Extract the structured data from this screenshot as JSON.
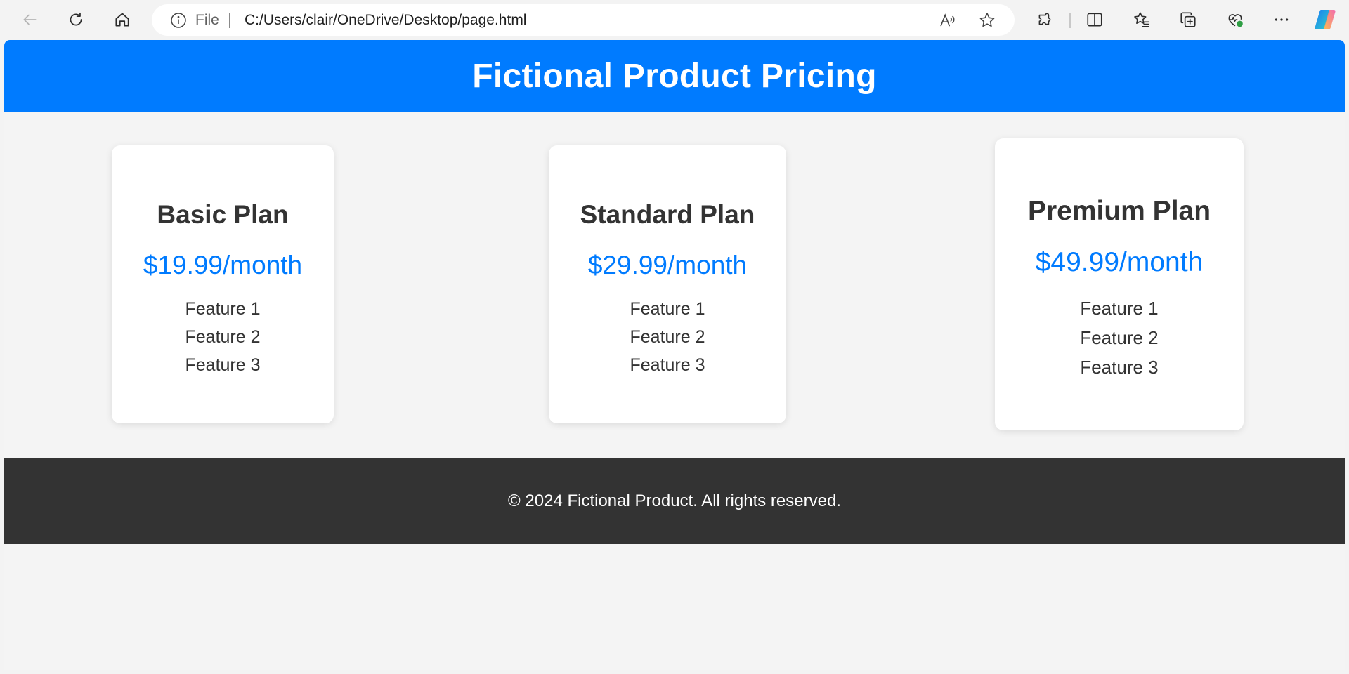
{
  "browser": {
    "address": {
      "scheme_label": "File",
      "url": "C:/Users/clair/OneDrive/Desktop/page.html"
    },
    "icons": [
      "back-icon",
      "refresh-icon",
      "home-icon",
      "info-icon",
      "read-aloud-icon",
      "favorite-star-icon",
      "extensions-icon",
      "split-screen-icon",
      "favorites-icon",
      "collections-icon",
      "browser-essentials-icon",
      "more-icon",
      "copilot-icon"
    ]
  },
  "page": {
    "header": {
      "title": "Fictional Product Pricing"
    },
    "plans": [
      {
        "name": "Basic Plan",
        "price": "$19.99/month",
        "features": [
          "Feature 1",
          "Feature 2",
          "Feature 3"
        ]
      },
      {
        "name": "Standard Plan",
        "price": "$29.99/month",
        "features": [
          "Feature 1",
          "Feature 2",
          "Feature 3"
        ]
      },
      {
        "name": "Premium Plan",
        "price": "$49.99/month",
        "features": [
          "Feature 1",
          "Feature 2",
          "Feature 3"
        ]
      }
    ],
    "footer": {
      "text": "© 2024 Fictional Product. All rights reserved."
    }
  },
  "colors": {
    "header_bg": "#007bff",
    "price": "#007bff",
    "footer_bg": "#333333",
    "page_bg": "#f4f4f4",
    "card_bg": "#ffffff"
  }
}
